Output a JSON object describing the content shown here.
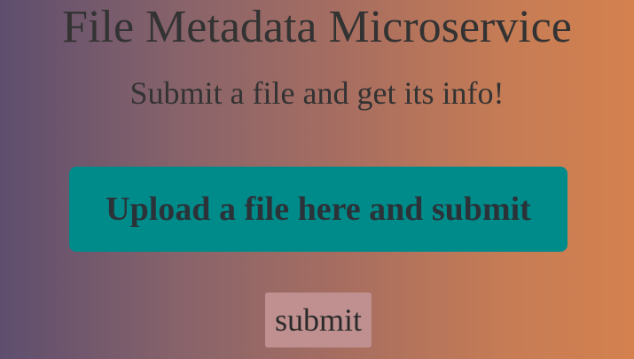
{
  "header": {
    "title": "File Metadata Microservice",
    "subtitle": "Submit a file and get its info!"
  },
  "upload": {
    "label": "Upload a file here and submit"
  },
  "form": {
    "submit_label": "submit"
  },
  "colors": {
    "upload_background": "#008b8b",
    "submit_background": "#c09090",
    "text": "#333333",
    "gradient_start": "#5e4e6e",
    "gradient_end": "#d4814e"
  }
}
